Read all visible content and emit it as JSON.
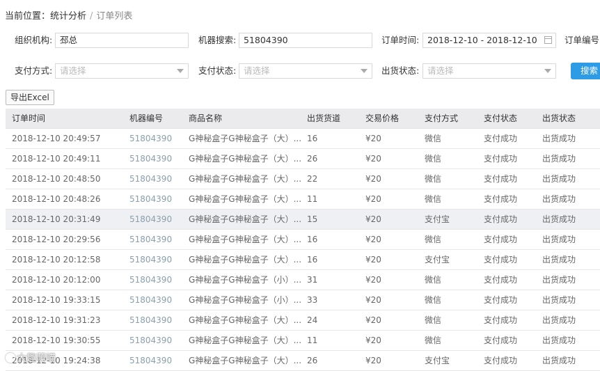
{
  "breadcrumb": {
    "prefix": "当前位置：",
    "section": "统计分析",
    "separator": "/",
    "current": "订单列表"
  },
  "filters": {
    "org": {
      "label": "组织机构:",
      "value": "邳总"
    },
    "machine": {
      "label": "机器搜索:",
      "value": "51804390"
    },
    "order_time": {
      "label": "订单时间:",
      "value": "2018-12-10 - 2018-12-10"
    },
    "order_no": {
      "label": "订单编号:"
    },
    "pay_method": {
      "label": "支付方式:",
      "placeholder": "请选择"
    },
    "pay_status": {
      "label": "支付状态:",
      "placeholder": "请选择"
    },
    "ship_status": {
      "label": "出货状态:",
      "placeholder": "请选择"
    },
    "search_label": "搜索"
  },
  "toolbar": {
    "export_label": "导出Excel"
  },
  "table": {
    "headers": [
      "订单时间",
      "机器编号",
      "商品名称",
      "出货货道",
      "交易价格",
      "支付方式",
      "支付状态",
      "出货状态"
    ],
    "rows": [
      [
        "2018-12-10 20:49:57",
        "51804390",
        "G神秘盒子G神秘盒子（大）...",
        "16",
        "¥20",
        "微信",
        "支付成功",
        "出货成功"
      ],
      [
        "2018-12-10 20:49:11",
        "51804390",
        "G神秘盒子G神秘盒子（大）...",
        "26",
        "¥20",
        "微信",
        "支付成功",
        "出货成功"
      ],
      [
        "2018-12-10 20:48:50",
        "51804390",
        "G神秘盒子G神秘盒子（大）...",
        "22",
        "¥20",
        "微信",
        "支付成功",
        "出货成功"
      ],
      [
        "2018-12-10 20:48:26",
        "51804390",
        "G神秘盒子G神秘盒子（大）...",
        "11",
        "¥20",
        "微信",
        "支付成功",
        "出货成功"
      ],
      [
        "2018-12-10 20:31:49",
        "51804390",
        "G神秘盒子G神秘盒子（大）...",
        "15",
        "¥20",
        "支付宝",
        "支付成功",
        "出货成功"
      ],
      [
        "2018-12-10 20:29:56",
        "51804390",
        "G神秘盒子G神秘盒子（大）...",
        "16",
        "¥20",
        "微信",
        "支付成功",
        "出货成功"
      ],
      [
        "2018-12-10 20:12:58",
        "51804390",
        "G神秘盒子G神秘盒子（大）...",
        "16",
        "¥20",
        "支付宝",
        "支付成功",
        "出货成功"
      ],
      [
        "2018-12-10 20:12:00",
        "51804390",
        "G神秘盒子G神秘盒子（小）...",
        "31",
        "¥20",
        "微信",
        "支付成功",
        "出货成功"
      ],
      [
        "2018-12-10 19:33:15",
        "51804390",
        "G神秘盒子G神秘盒子（小）...",
        "33",
        "¥20",
        "微信",
        "支付成功",
        "出货成功"
      ],
      [
        "2018-12-10 19:31:23",
        "51804390",
        "G神秘盒子G神秘盒子（大）...",
        "24",
        "¥20",
        "微信",
        "支付成功",
        "出货成功"
      ],
      [
        "2018-12-10 19:30:55",
        "51804390",
        "G神秘盒子G神秘盒子（大）...",
        "11",
        "¥20",
        "微信",
        "支付成功",
        "出货成功"
      ],
      [
        "2018-12-10 19:24:38",
        "51804390",
        "G神秘盒子G神秘盒子（大）...",
        "26",
        "¥20",
        "支付宝",
        "支付成功",
        "出货成功"
      ]
    ]
  },
  "watermark": {
    "text": "大趣萌喵"
  }
}
